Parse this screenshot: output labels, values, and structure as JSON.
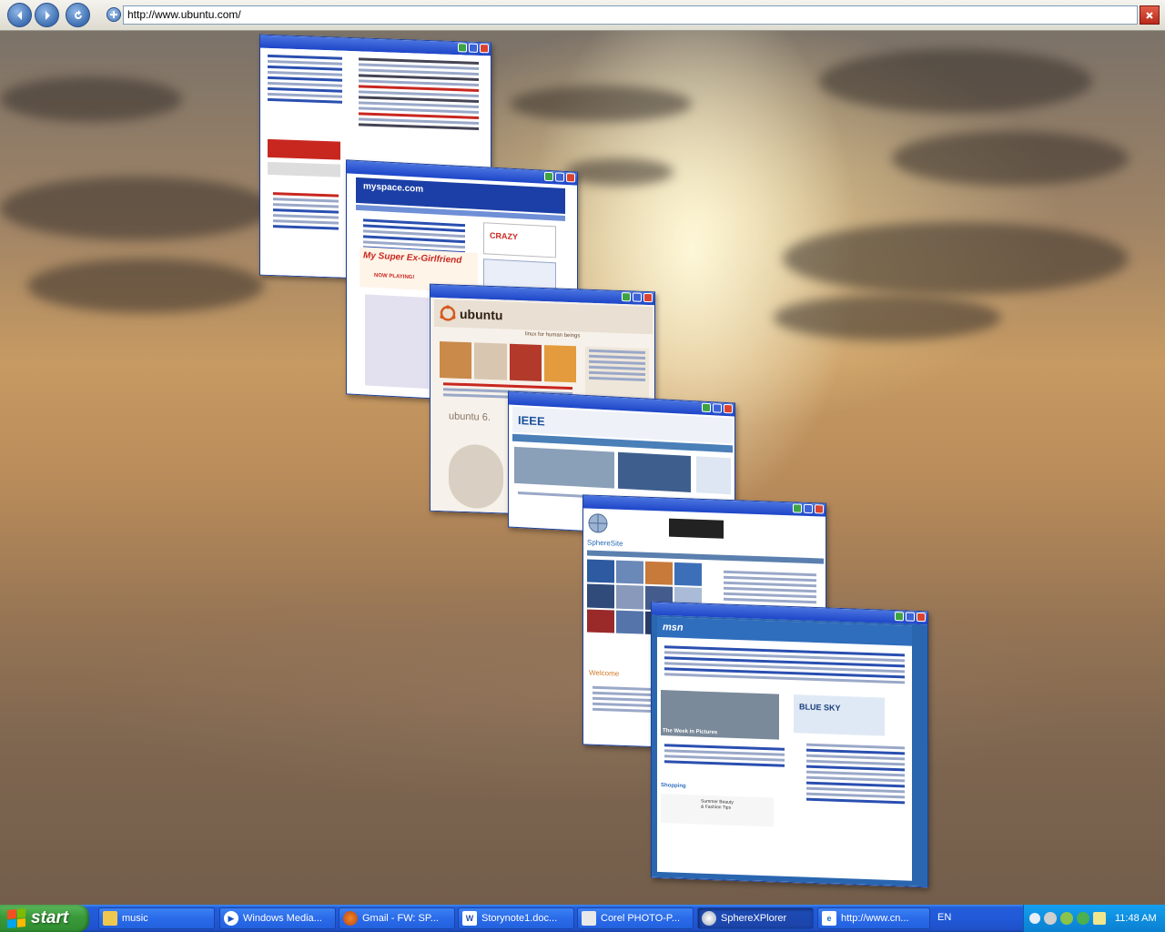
{
  "browser": {
    "address_url": "http://www.ubuntu.com/",
    "back_icon": "back-arrow-icon",
    "forward_icon": "forward-arrow-icon",
    "reload_icon": "reload-icon",
    "new_tab_icon": "plus-icon"
  },
  "windows": [
    {
      "id": "cnn",
      "site": "cnn"
    },
    {
      "id": "myspace",
      "site": "myspace",
      "logo": "myspace.com",
      "ad_text": "CRAZY",
      "promo_text": "My Super Ex-Girlfriend",
      "promo_sub": "NOW PLAYING!"
    },
    {
      "id": "ubuntu",
      "site": "ubuntu",
      "logo": "ubuntu",
      "tagline": "linux for human beings",
      "banner": "ubuntu 6."
    },
    {
      "id": "ieee",
      "site": "ieee",
      "logo": "IEEE"
    },
    {
      "id": "spheresite",
      "site": "spheresite",
      "logo": "SphereSite",
      "welcome": "Welcome"
    },
    {
      "id": "msn",
      "site": "msn",
      "logo": "msn",
      "feature_title": "BLUE SKY",
      "feature_caption": "The Week in Pictures",
      "shopping": "Shopping",
      "shopping_promo": "Summer Beauty & Fashion Tips"
    }
  ],
  "taskbar": {
    "start_label": "start",
    "tasks": [
      {
        "label": "music",
        "icon": "folder-icon"
      },
      {
        "label": "Windows Media...",
        "icon": "media-player-icon"
      },
      {
        "label": "Gmail - FW: SP...",
        "icon": "firefox-icon"
      },
      {
        "label": "Storynote1.doc...",
        "icon": "word-icon"
      },
      {
        "label": "Corel PHOTO-P...",
        "icon": "corel-icon"
      },
      {
        "label": "SphereXPlorer",
        "icon": "spherexplorer-icon",
        "active": true
      },
      {
        "label": "http://www.cn...",
        "icon": "ie-icon"
      }
    ],
    "language": "EN",
    "clock": "11:48 AM"
  },
  "colors": {
    "xp_blue": "#245edb",
    "start_green": "#3a9a3a",
    "title_blue": "#1d45c8"
  }
}
